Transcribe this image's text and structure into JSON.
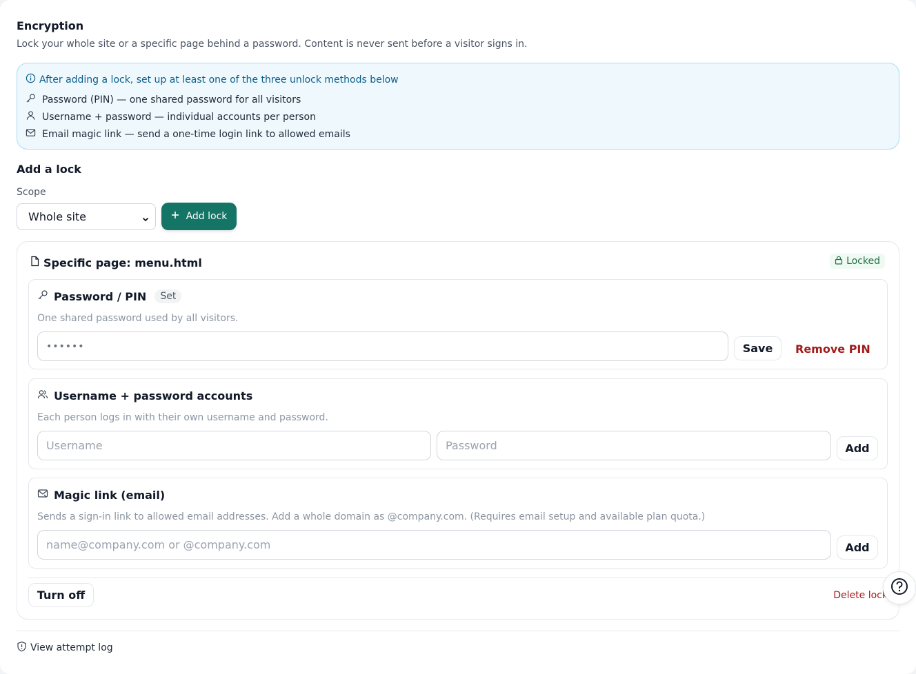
{
  "header": {
    "title": "Encryption",
    "subtitle": "Lock your whole site or a specific page behind a password. Content is never sent before a visitor signs in."
  },
  "info_box": {
    "heading": "After adding a lock, set up at least one of the three unlock methods below",
    "methods": [
      {
        "icon": "key-icon",
        "text": "Password (PIN) — one shared password for all visitors"
      },
      {
        "icon": "user-icon",
        "text": "Username + password — individual accounts per person"
      },
      {
        "icon": "mail-icon",
        "text": "Email magic link — send a one-time login link to allowed emails"
      }
    ]
  },
  "add_lock": {
    "heading": "Add a lock",
    "scope_label": "Scope",
    "scope_value": "Whole site",
    "button_label": "Add lock"
  },
  "lock": {
    "title": "Specific page: menu.html",
    "status": "Locked",
    "pin": {
      "title": "Password / PIN",
      "badge": "Set",
      "description": "One shared password used by all visitors.",
      "value": "••••••",
      "save_label": "Save",
      "remove_label": "Remove PIN"
    },
    "accounts": {
      "title": "Username + password accounts",
      "description": "Each person logs in with their own username and password.",
      "username_placeholder": "Username",
      "password_placeholder": "Password",
      "add_label": "Add"
    },
    "magic": {
      "title": "Magic link (email)",
      "description": "Sends a sign-in link to allowed email addresses. Add a whole domain as @company.com. (Requires email setup and available plan quota.)",
      "email_placeholder": "name@company.com or @company.com",
      "add_label": "Add"
    },
    "turn_off_label": "Turn off",
    "delete_label": "Delete lock"
  },
  "footer": {
    "attempt_log_label": "View attempt log"
  },
  "colors": {
    "accent": "#147466",
    "danger": "#a11b1b",
    "info_bg": "#eef8fd",
    "info_border": "#a9dcf4",
    "locked_bg": "#effaf3"
  }
}
